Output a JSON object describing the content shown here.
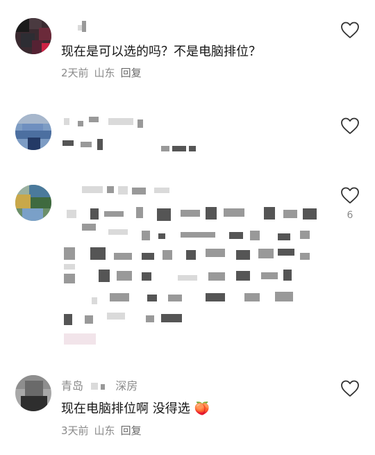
{
  "comments": [
    {
      "text": "现在是可以选的吗？不是电脑排位？",
      "time": "2天前",
      "location": "山东",
      "reply": "回复"
    },
    {},
    {
      "like_count": "6"
    },
    {
      "username_start": "青岛",
      "username_end": "深房",
      "text": "现在电脑排位啊 没得选",
      "emoji": "🍑",
      "time": "3天前",
      "location": "山东",
      "reply": "回复"
    }
  ],
  "icons": {
    "like": "heart-outline-icon"
  },
  "colors": {
    "text": "#161616",
    "meta": "#8a8a8a",
    "like_stroke": "#333333"
  }
}
